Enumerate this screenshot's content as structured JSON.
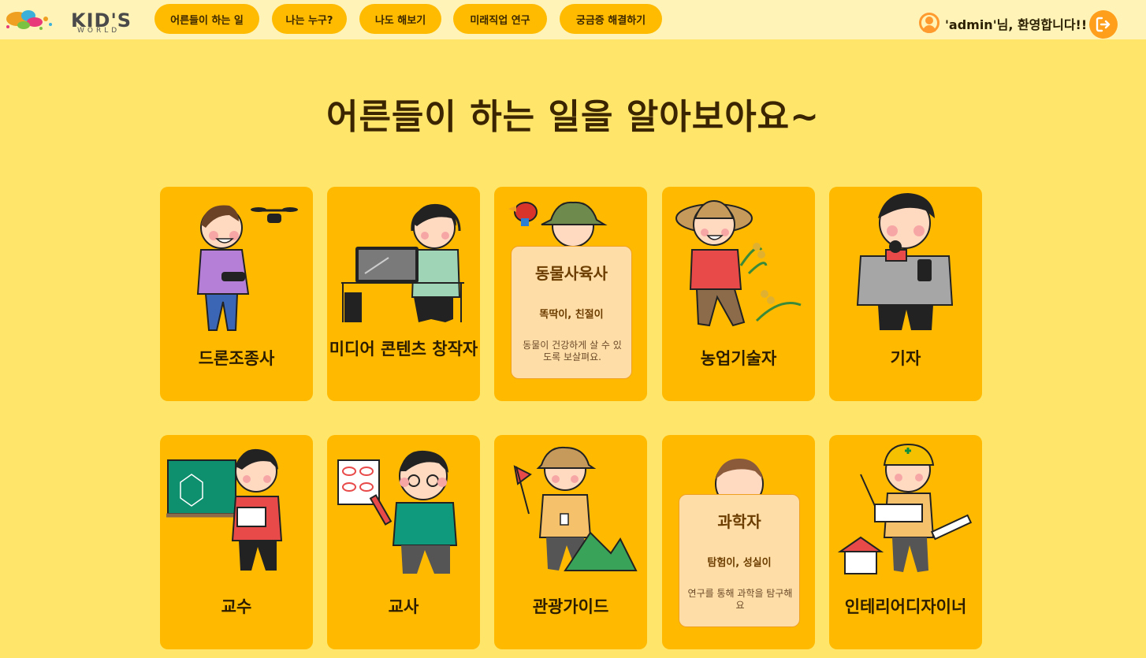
{
  "brand": {
    "logo_text": "KID'S",
    "logo_sub": "WORLD"
  },
  "nav": [
    {
      "label": "어른들이 하는 일"
    },
    {
      "label": "나는 누구?"
    },
    {
      "label": "나도 해보기"
    },
    {
      "label": "미래직업 연구"
    },
    {
      "label": "궁금증 해결하기"
    }
  ],
  "user": {
    "welcome": "'admin'님, 환영합니다!!"
  },
  "page_title": "어른들이 하는 일을 알아보아요~",
  "jobs": [
    {
      "name": "드론조종사"
    },
    {
      "name": "미디어 콘텐츠 창작자"
    },
    {
      "name": "동물사육사",
      "traits": "똑딱이, 친절이",
      "desc": "동물이 건강하게 살 수 있도록 보살펴요."
    },
    {
      "name": "농업기술자"
    },
    {
      "name": "기자"
    },
    {
      "name": "교수"
    },
    {
      "name": "교사"
    },
    {
      "name": "관광가이드"
    },
    {
      "name": "과학자",
      "traits": "탐험이, 성실이",
      "desc": "연구를 통해 과학을 탐구해요"
    },
    {
      "name": "인테리어디자이너"
    }
  ],
  "colors": {
    "background": "#ffe66b",
    "header": "#fff3b8",
    "card": "#ffba00",
    "nav_button": "#ffbb00",
    "hover_box": "#ffdda6",
    "logout": "#ff9f1c"
  }
}
